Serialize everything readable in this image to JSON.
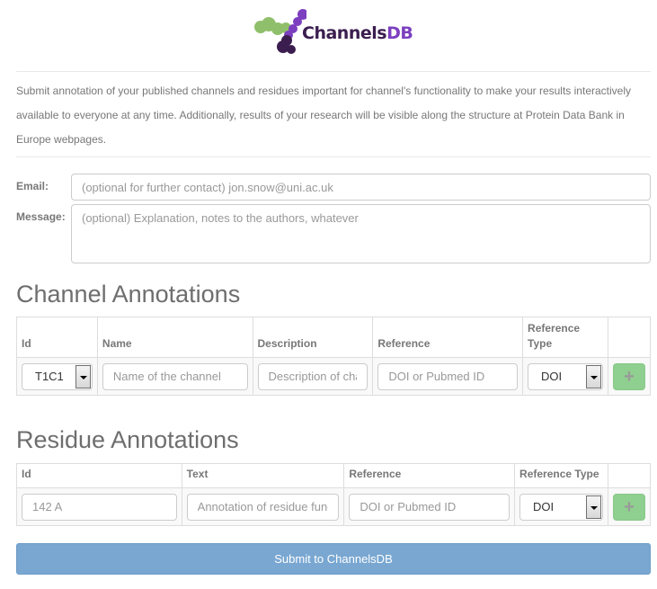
{
  "logo": {
    "text_main": "Channels",
    "text_accent": "DB"
  },
  "intro": "Submit annotation of your published channels and residues important for channel's functionality to make your results interactively available to everyone at any time. Additionally, results of your research will be visible along the structure at Protein Data Bank in Europe webpages.",
  "form": {
    "email_label": "Email:",
    "email_placeholder": "(optional for further contact) jon.snow@uni.ac.uk",
    "message_label": "Message:",
    "message_placeholder": "(optional) Explanation, notes to the authors, whatever"
  },
  "channel": {
    "title": "Channel Annotations",
    "headers": [
      "Id",
      "Name",
      "Description",
      "Reference",
      "Reference Type"
    ],
    "row": {
      "id_value": "T1C1",
      "name_placeholder": "Name of the channel",
      "description_placeholder": "Description of channel",
      "reference_placeholder": "DOI or Pubmed ID",
      "reference_type": "DOI",
      "add_label": "+"
    }
  },
  "residue": {
    "title": "Residue Annotations",
    "headers": [
      "Id",
      "Text",
      "Reference",
      "Reference Type"
    ],
    "row": {
      "id_placeholder": "142 A",
      "text_placeholder": "Annotation of residue function",
      "reference_placeholder": "DOI or Pubmed ID",
      "reference_type": "DOI",
      "add_label": "+"
    }
  },
  "submit_label": "Submit to ChannelsDB",
  "colors": {
    "logo_green": "#8fbf6a",
    "logo_purple": "#7b3fbf",
    "logo_dark": "#3b1e4f",
    "add_button": "#8fcf8f",
    "submit_button": "#79a7d1"
  }
}
